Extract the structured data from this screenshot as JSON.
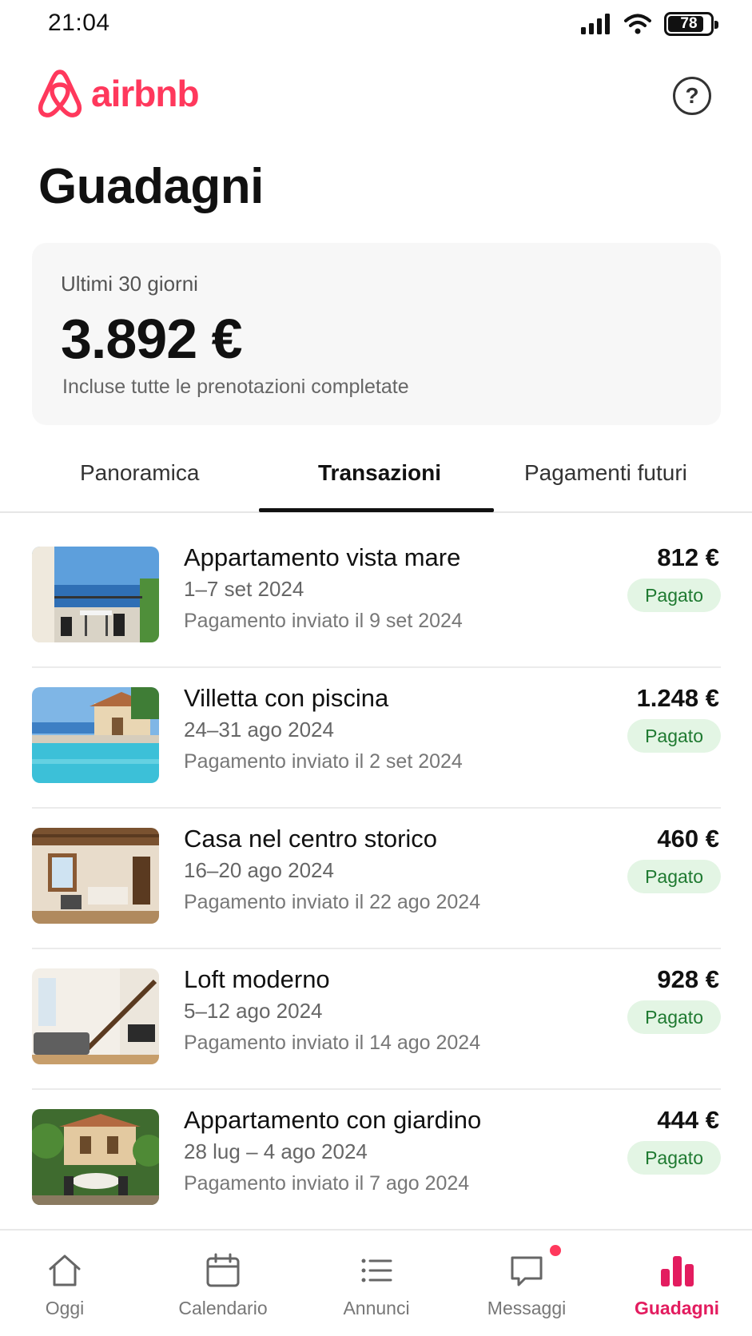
{
  "status_bar": {
    "time": "21:04",
    "battery": "78",
    "icons": [
      "signal-icon",
      "wifi-icon",
      "battery-icon"
    ]
  },
  "header": {
    "brand": "airbnb",
    "brand_color": "#ff385c",
    "help_icon": "question-circle-icon",
    "help_symbol": "?"
  },
  "page": {
    "title": "Guadagni"
  },
  "summary": {
    "period": "Ultimi 30 giorni",
    "amount": "3.892 €",
    "note": "Incluse tutte le prenotazioni completate"
  },
  "tabs": [
    {
      "label": "Panoramica",
      "active": false
    },
    {
      "label": "Transazioni",
      "active": true
    },
    {
      "label": "Pagamenti futuri",
      "active": false
    }
  ],
  "transactions": [
    {
      "title": "Appartamento vista mare",
      "dates": "1–7 set 2024",
      "payment": "Pagamento inviato il 9 set 2024",
      "amount": "812 €",
      "status": "Pagato"
    },
    {
      "title": "Villetta con piscina",
      "dates": "24–31 ago 2024",
      "payment": "Pagamento inviato il 2 set 2024",
      "amount": "1.248 €",
      "status": "Pagato"
    },
    {
      "title": "Casa nel centro storico",
      "dates": "16–20 ago 2024",
      "payment": "Pagamento inviato il 22 ago 2024",
      "amount": "460 €",
      "status": "Pagato"
    },
    {
      "title": "Loft moderno",
      "dates": "5–12 ago 2024",
      "payment": "Pagamento inviato il 14 ago 2024",
      "amount": "928 €",
      "status": "Pagato"
    },
    {
      "title": "Appartamento con giardino",
      "dates": "28 lug – 4 ago 2024",
      "payment": "Pagamento inviato il 7 ago 2024",
      "amount": "444 €",
      "status": "Pagato"
    }
  ],
  "bottom_nav": [
    {
      "label": "Oggi",
      "icon": "home-icon",
      "active": false
    },
    {
      "label": "Calendario",
      "icon": "calendar-icon",
      "active": false
    },
    {
      "label": "Annunci",
      "icon": "list-icon",
      "active": false
    },
    {
      "label": "Messaggi",
      "icon": "message-icon",
      "active": false,
      "notification": true
    },
    {
      "label": "Guadagni",
      "icon": "bar-chart-icon",
      "active": true
    }
  ],
  "colors": {
    "accent": "#ff385c",
    "active_nav": "#e31c5f",
    "badge_bg": "#e3f5e4",
    "badge_text": "#1f7a31"
  }
}
